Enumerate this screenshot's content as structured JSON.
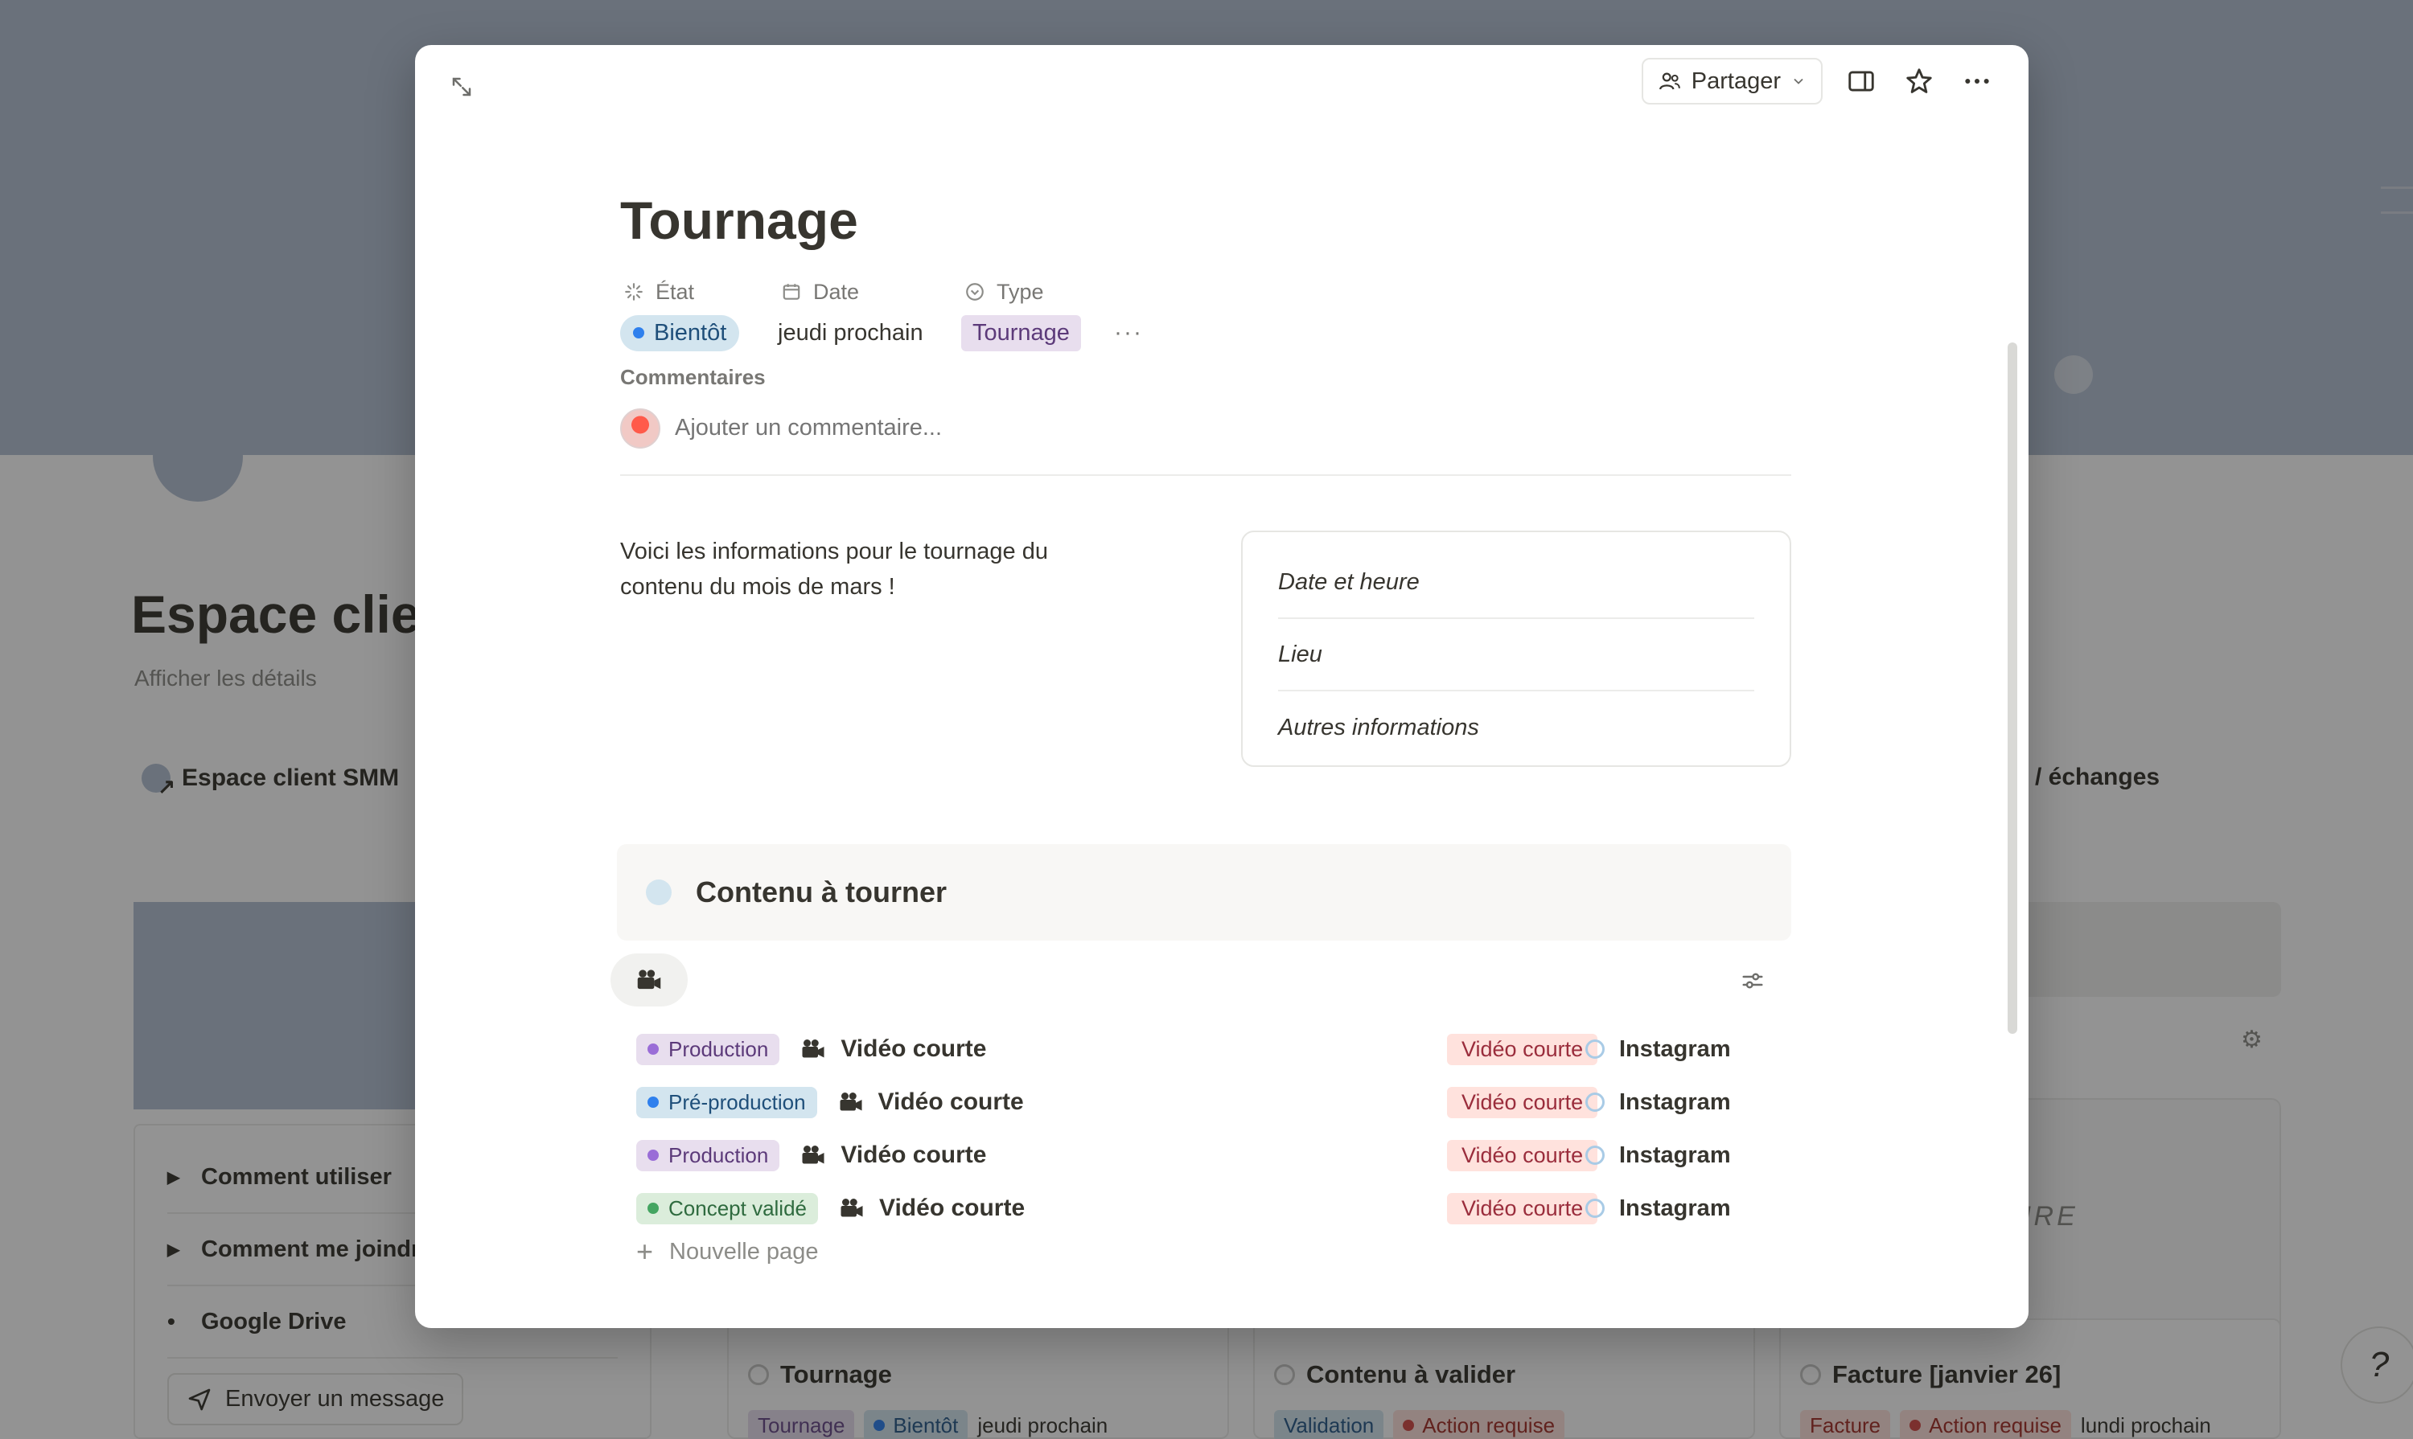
{
  "background": {
    "page_title": "Espace client SMM",
    "details_link": "Afficher les détails",
    "linked_page": "Espace client SMM",
    "linked_right": "/ échanges",
    "toggles": [
      {
        "label": "Comment utiliser",
        "kind": "toggle"
      },
      {
        "label": "Comment me joindre",
        "kind": "toggle"
      },
      {
        "label": "Google Drive",
        "kind": "bullet"
      }
    ],
    "send_button": "Envoyer un message",
    "card_script": "URE",
    "cards": [
      {
        "title": "Tournage",
        "tags": [
          {
            "text": "Tournage",
            "style": "purple",
            "dot": false
          },
          {
            "text": "Bientôt",
            "style": "blue",
            "dot": true
          }
        ],
        "date": "jeudi prochain"
      },
      {
        "title": "Contenu à valider",
        "tags": [
          {
            "text": "Validation",
            "style": "blue",
            "dot": false
          },
          {
            "text": "Action requise",
            "style": "red",
            "dot": true
          }
        ],
        "date": ""
      },
      {
        "title": "Facture [janvier 26]",
        "tags": [
          {
            "text": "Facture",
            "style": "red",
            "dot": false
          },
          {
            "text": "Action requise",
            "style": "red",
            "dot": true
          }
        ],
        "date": "lundi prochain"
      }
    ]
  },
  "modal": {
    "share_label": "Partager",
    "title": "Tournage",
    "properties": [
      {
        "label": "État",
        "icon": "status-spinner-icon",
        "value": "Bientôt",
        "kind": "status"
      },
      {
        "label": "Date",
        "icon": "calendar-icon",
        "value": "jeudi prochain",
        "kind": "text"
      },
      {
        "label": "Type",
        "icon": "select-icon",
        "value": "Tournage",
        "kind": "tag"
      }
    ],
    "more_props": "···",
    "comments_label": "Commentaires",
    "comment_placeholder": "Ajouter un commentaire...",
    "intro_line1": "Voici les informations pour le tournage du",
    "intro_line2": "contenu du mois de mars !",
    "info_box": [
      "Date et heure",
      "Lieu",
      "Autres informations"
    ],
    "callout_title": "Contenu à tourner",
    "rows": [
      {
        "status": "Production",
        "status_color": "purple",
        "title": "Vidéo courte",
        "type": "Vidéo courte",
        "platform": "Instagram"
      },
      {
        "status": "Pré-production",
        "status_color": "blue",
        "title": "Vidéo courte",
        "type": "Vidéo courte",
        "platform": "Instagram"
      },
      {
        "status": "Production",
        "status_color": "purple",
        "title": "Vidéo courte",
        "type": "Vidéo courte",
        "platform": "Instagram"
      },
      {
        "status": "Concept validé",
        "status_color": "green",
        "title": "Vidéo courte",
        "type": "Vidéo courte",
        "platform": "Instagram"
      }
    ],
    "new_page_label": "Nouvelle page"
  },
  "colors": {
    "cover": "#b5c2d4",
    "status_blue": "#2f80ed",
    "status_purple": "#9a6dd7",
    "status_green": "#44a561",
    "type_tag_bg": "#ffe2dd"
  }
}
